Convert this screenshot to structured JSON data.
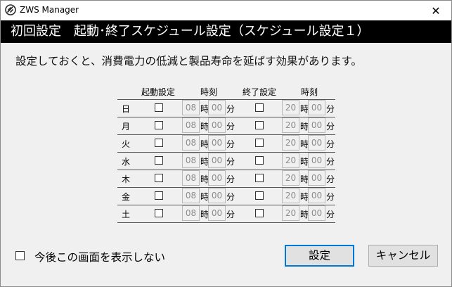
{
  "window": {
    "title": "ZWS Manager",
    "close_glyph": "✕",
    "app_icon": "zws-logo-icon"
  },
  "header": {
    "title": "初回設定　起動･終了スケジュール設定（スケジュール設定１）"
  },
  "description": "設定しておくと、消費電力の低減と製品寿命を延ばす効果があります。",
  "schedule": {
    "columns": {
      "start_label": "起動設定",
      "start_time_label": "時刻",
      "end_label": "終了設定",
      "end_time_label": "時刻"
    },
    "hour_unit": "時",
    "minute_unit": "分",
    "rows": [
      {
        "day": "日",
        "start_checked": false,
        "start_hour": "08",
        "start_minute": "00",
        "end_checked": false,
        "end_hour": "20",
        "end_minute": "00"
      },
      {
        "day": "月",
        "start_checked": false,
        "start_hour": "08",
        "start_minute": "00",
        "end_checked": false,
        "end_hour": "20",
        "end_minute": "00"
      },
      {
        "day": "火",
        "start_checked": false,
        "start_hour": "08",
        "start_minute": "00",
        "end_checked": false,
        "end_hour": "20",
        "end_minute": "00"
      },
      {
        "day": "水",
        "start_checked": false,
        "start_hour": "08",
        "start_minute": "00",
        "end_checked": false,
        "end_hour": "20",
        "end_minute": "00"
      },
      {
        "day": "木",
        "start_checked": false,
        "start_hour": "08",
        "start_minute": "00",
        "end_checked": false,
        "end_hour": "20",
        "end_minute": "00"
      },
      {
        "day": "金",
        "start_checked": false,
        "start_hour": "08",
        "start_minute": "00",
        "end_checked": false,
        "end_hour": "20",
        "end_minute": "00"
      },
      {
        "day": "土",
        "start_checked": false,
        "start_hour": "08",
        "start_minute": "00",
        "end_checked": false,
        "end_hour": "20",
        "end_minute": "00"
      }
    ]
  },
  "footer": {
    "dont_show_label": "今後この画面を表示しない",
    "dont_show_checked": false,
    "ok_label": "設定",
    "cancel_label": "キャンセル"
  },
  "colors": {
    "header_bg": "#000000",
    "header_text": "#ffffff",
    "dialog_bg": "#f0f0f0",
    "focus_accent": "#0078d7"
  }
}
